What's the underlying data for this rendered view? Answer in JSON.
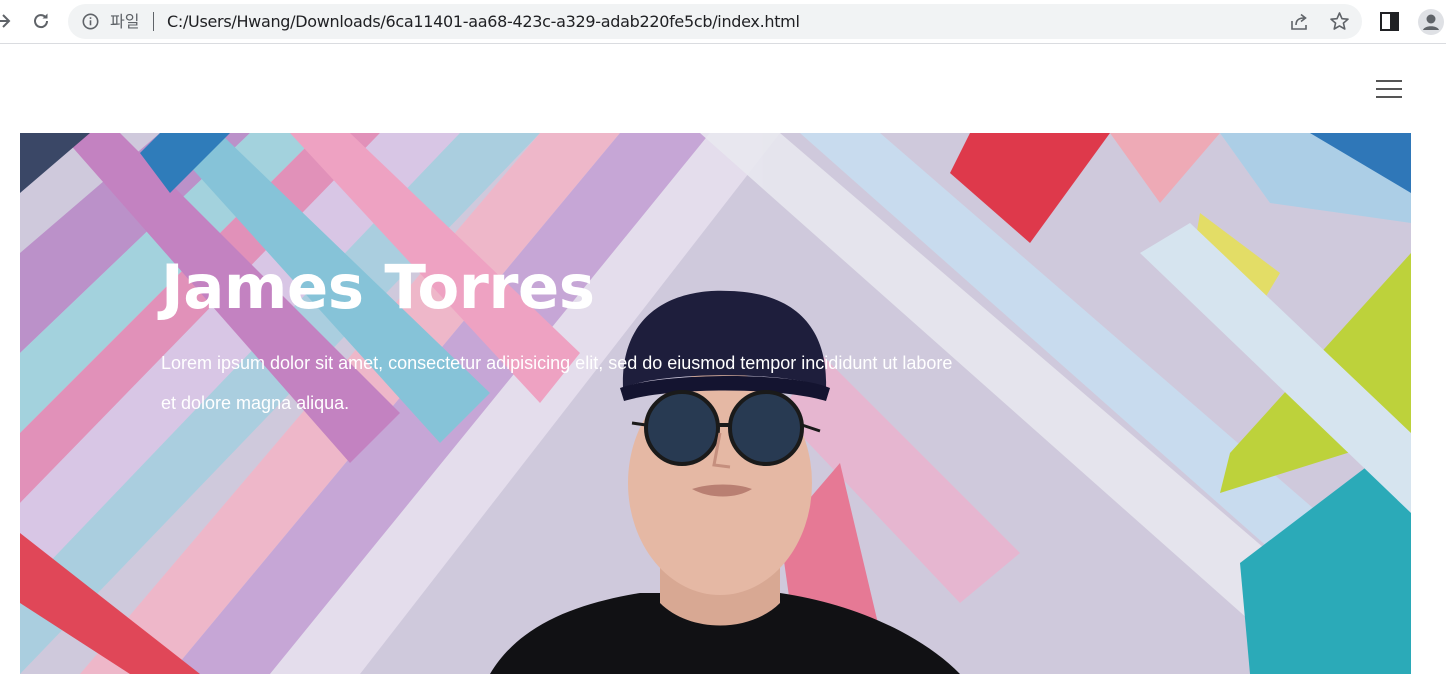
{
  "browser": {
    "file_label": "파일",
    "url": "C:/Users/Hwang/Downloads/6ca11401-aa68-423c-a329-adab220fe5cb/index.html",
    "icons": [
      "forward-arrow-icon",
      "reload-icon",
      "info-icon",
      "share-icon",
      "bookmark-star-icon",
      "side-panel-icon",
      "profile-icon"
    ]
  },
  "page": {
    "menu_icon": "hamburger-menu-icon",
    "hero": {
      "title": "James Torres",
      "description": "Lorem ipsum dolor sit amet, consectetur adipisicing elit, sed do eiusmod tempor incididunt ut labore et dolore magna aliqua.",
      "image": "young man in cap and round sunglasses in front of colorful graffiti wall"
    }
  },
  "colors": {
    "toolbar_bg": "#ffffff",
    "omnibox_bg": "#f1f3f4",
    "icon_gray": "#5f6368",
    "hero_text": "#ffffff",
    "menu_lines": "#555555"
  }
}
